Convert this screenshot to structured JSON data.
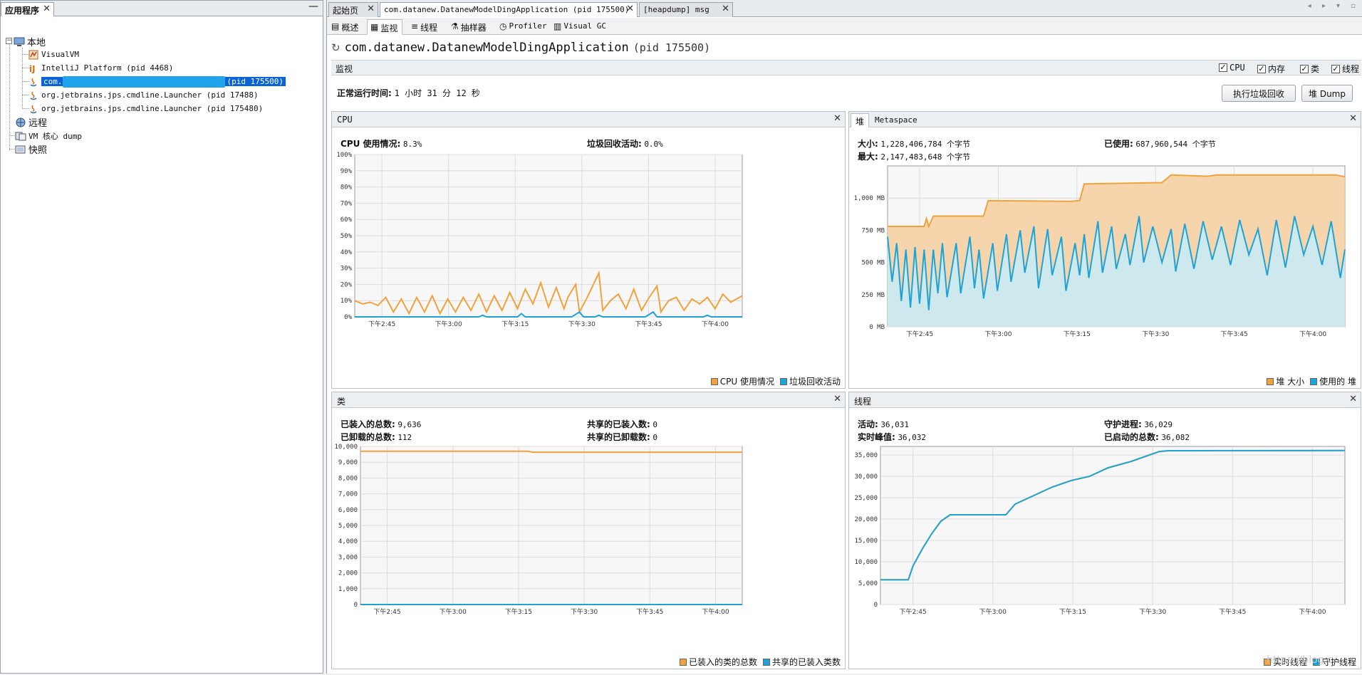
{
  "colors": {
    "orange": "#f2a23c",
    "orange_fill": "#f7cf9f",
    "blue": "#1fa3d4",
    "blue_fill": "#c7ecf9",
    "selection": "#0a64d8",
    "grid": "#d8d8d8"
  },
  "left": {
    "tab_label": "应用程序",
    "tree": {
      "local": "本地",
      "visualvm": "VisualVM",
      "intellij": "IntelliJ Platform (pid 4468)",
      "selected_prefix": "com.",
      "selected_pid": "(pid 175500)",
      "launcher1": "org.jetbrains.jps.cmdline.Launcher (pid 17488)",
      "launcher2": "org.jetbrains.jps.cmdline.Launcher (pid 175480)",
      "remote": "远程",
      "vm_core": "VM 核心 dump",
      "snapshot": "快照"
    }
  },
  "tabs": {
    "start": "起始页",
    "app": "com.datanew.DatanewModelDingApplication (pid 175500)",
    "heapdump": "[heapdump] msg"
  },
  "subtabs": {
    "overview": "概述",
    "monitor": "监视",
    "threads": "线程",
    "sampler": "抽样器",
    "profiler": "Profiler",
    "visualgc": "Visual GC"
  },
  "header": {
    "name": "com.datanew.DatanewModelDingApplication",
    "pid": "(pid 175500)",
    "monitor_label": "监视",
    "checks": {
      "cpu": "CPU",
      "memory": "内存",
      "classes": "类",
      "threads": "线程"
    },
    "uptime_label": "正常运行时间:",
    "uptime_value": "1 小时 31 分 12 秒",
    "gc_button": "执行垃圾回收",
    "heap_dump_button": "堆 Dump",
    "check_mark": "✓"
  },
  "cpu_panel": {
    "title": "CPU",
    "usage_label": "CPU 使用情况:",
    "usage_value": "8.3%",
    "gc_label": "垃圾回收活动:",
    "gc_value": "0.0%"
  },
  "heap_panel": {
    "tab_heap": "堆",
    "tab_metaspace": "Metaspace",
    "size_label": "大小:",
    "size_value": "1,228,406,784 个字节",
    "max_label": "最大:",
    "max_value": "2,147,483,648 个字节",
    "used_label": "已使用:",
    "used_value": "687,960,544 个字节"
  },
  "classes_panel": {
    "title": "类",
    "loaded_label": "已装入的总数:",
    "loaded_value": "9,636",
    "unloaded_label": "已卸载的总数:",
    "unloaded_value": "112",
    "shared_loaded_label": "共享的已装入数:",
    "shared_loaded_value": "0",
    "shared_unloaded_label": "共享的已卸载数:",
    "shared_unloaded_value": "0"
  },
  "threads_panel": {
    "title": "线程",
    "live_label": "活动:",
    "live_value": "36,031",
    "peak_label": "实时峰值:",
    "peak_value": "36,032",
    "daemon_label": "守护进程:",
    "daemon_value": "36,029",
    "started_label": "已启动的总数:",
    "started_value": "36,082"
  },
  "watermark": "https://blog.c...",
  "chart_data": [
    {
      "id": "cpu",
      "type": "line",
      "x": [
        "下午2:45",
        "下午3:00",
        "下午3:15",
        "下午3:30",
        "下午3:45",
        "下午4:00"
      ],
      "yticks": [
        "0%",
        "10%",
        "20%",
        "30%",
        "40%",
        "50%",
        "60%",
        "70%",
        "80%",
        "90%",
        "100%"
      ],
      "ylim": [
        0,
        100
      ],
      "series": [
        {
          "name": "CPU 使用情况",
          "color": "#f2a23c",
          "points": [
            [
              0,
              10
            ],
            [
              0.02,
              8
            ],
            [
              0.04,
              9
            ],
            [
              0.06,
              7
            ],
            [
              0.08,
              12
            ],
            [
              0.1,
              3
            ],
            [
              0.12,
              11
            ],
            [
              0.14,
              2
            ],
            [
              0.16,
              12
            ],
            [
              0.18,
              3
            ],
            [
              0.2,
              13
            ],
            [
              0.22,
              2
            ],
            [
              0.24,
              11
            ],
            [
              0.26,
              3
            ],
            [
              0.28,
              12
            ],
            [
              0.3,
              4
            ],
            [
              0.32,
              14
            ],
            [
              0.34,
              3
            ],
            [
              0.36,
              13
            ],
            [
              0.38,
              4
            ],
            [
              0.4,
              15
            ],
            [
              0.42,
              5
            ],
            [
              0.44,
              17
            ],
            [
              0.46,
              8
            ],
            [
              0.48,
              21
            ],
            [
              0.5,
              6
            ],
            [
              0.52,
              18
            ],
            [
              0.54,
              5
            ],
            [
              0.55,
              12
            ],
            [
              0.57,
              20
            ],
            [
              0.58,
              3
            ],
            [
              0.6,
              12
            ],
            [
              0.63,
              27
            ],
            [
              0.64,
              4
            ],
            [
              0.66,
              10
            ],
            [
              0.68,
              14
            ],
            [
              0.7,
              5
            ],
            [
              0.72,
              17
            ],
            [
              0.74,
              4
            ],
            [
              0.76,
              12
            ],
            [
              0.78,
              19
            ],
            [
              0.79,
              3
            ],
            [
              0.81,
              10
            ],
            [
              0.83,
              12
            ],
            [
              0.85,
              4
            ],
            [
              0.87,
              11
            ],
            [
              0.89,
              8
            ],
            [
              0.91,
              12
            ],
            [
              0.93,
              5
            ],
            [
              0.95,
              14
            ],
            [
              0.97,
              9
            ],
            [
              1,
              13
            ]
          ]
        },
        {
          "name": "垃圾回收活动",
          "color": "#1fa3d4",
          "points": [
            [
              0,
              0
            ],
            [
              0.32,
              0
            ],
            [
              0.33,
              1
            ],
            [
              0.34,
              0
            ],
            [
              0.42,
              0
            ],
            [
              0.43,
              2
            ],
            [
              0.44,
              0
            ],
            [
              0.56,
              0
            ],
            [
              0.58,
              3
            ],
            [
              0.59,
              0
            ],
            [
              0.62,
              0
            ],
            [
              0.63,
              1
            ],
            [
              0.64,
              0
            ],
            [
              0.75,
              0
            ],
            [
              0.77,
              3
            ],
            [
              0.78,
              0
            ],
            [
              0.9,
              0
            ],
            [
              0.91,
              1
            ],
            [
              0.92,
              0
            ],
            [
              1,
              0
            ]
          ]
        }
      ]
    },
    {
      "id": "heap",
      "type": "area",
      "x": [
        "下午2:45",
        "下午3:00",
        "下午3:15",
        "下午3:30",
        "下午3:45",
        "下午4:00"
      ],
      "yticks": [
        "0 MB",
        "250 MB",
        "500 MB",
        "750 MB",
        "1,000 MB"
      ],
      "ylim": [
        0,
        1250
      ],
      "series": [
        {
          "name": "堆 大小",
          "color": "#f2a23c",
          "fill": "#f7cf9f",
          "points": [
            [
              0,
              780
            ],
            [
              0.08,
              780
            ],
            [
              0.085,
              840
            ],
            [
              0.09,
              780
            ],
            [
              0.1,
              860
            ],
            [
              0.21,
              860
            ],
            [
              0.22,
              980
            ],
            [
              0.4,
              975
            ],
            [
              0.42,
              980
            ],
            [
              0.43,
              1110
            ],
            [
              0.6,
              1120
            ],
            [
              0.62,
              1180
            ],
            [
              0.7,
              1170
            ],
            [
              0.72,
              1180
            ],
            [
              0.98,
              1180
            ],
            [
              1,
              1165
            ]
          ]
        },
        {
          "name": "使用的 堆",
          "color": "#1fa3d4",
          "fill": "#c7ecf9",
          "points": [
            [
              0,
              700
            ],
            [
              0.01,
              350
            ],
            [
              0.02,
              650
            ],
            [
              0.03,
              200
            ],
            [
              0.04,
              600
            ],
            [
              0.05,
              150
            ],
            [
              0.06,
              620
            ],
            [
              0.07,
              180
            ],
            [
              0.08,
              600
            ],
            [
              0.09,
              130
            ],
            [
              0.1,
              600
            ],
            [
              0.11,
              260
            ],
            [
              0.12,
              650
            ],
            [
              0.13,
              230
            ],
            [
              0.15,
              650
            ],
            [
              0.16,
              260
            ],
            [
              0.18,
              700
            ],
            [
              0.19,
              300
            ],
            [
              0.2,
              600
            ],
            [
              0.21,
              220
            ],
            [
              0.23,
              650
            ],
            [
              0.24,
              280
            ],
            [
              0.26,
              720
            ],
            [
              0.27,
              350
            ],
            [
              0.29,
              750
            ],
            [
              0.3,
              420
            ],
            [
              0.32,
              780
            ],
            [
              0.33,
              300
            ],
            [
              0.35,
              760
            ],
            [
              0.36,
              400
            ],
            [
              0.38,
              700
            ],
            [
              0.39,
              280
            ],
            [
              0.41,
              650
            ],
            [
              0.42,
              400
            ],
            [
              0.43,
              720
            ],
            [
              0.44,
              380
            ],
            [
              0.46,
              820
            ],
            [
              0.47,
              420
            ],
            [
              0.49,
              780
            ],
            [
              0.5,
              450
            ],
            [
              0.52,
              720
            ],
            [
              0.53,
              480
            ],
            [
              0.55,
              860
            ],
            [
              0.56,
              500
            ],
            [
              0.58,
              780
            ],
            [
              0.6,
              500
            ],
            [
              0.62,
              760
            ],
            [
              0.63,
              430
            ],
            [
              0.65,
              800
            ],
            [
              0.67,
              450
            ],
            [
              0.69,
              820
            ],
            [
              0.71,
              520
            ],
            [
              0.73,
              780
            ],
            [
              0.75,
              480
            ],
            [
              0.77,
              830
            ],
            [
              0.79,
              560
            ],
            [
              0.81,
              760
            ],
            [
              0.83,
              400
            ],
            [
              0.85,
              830
            ],
            [
              0.87,
              460
            ],
            [
              0.89,
              860
            ],
            [
              0.91,
              560
            ],
            [
              0.93,
              780
            ],
            [
              0.95,
              480
            ],
            [
              0.97,
              820
            ],
            [
              0.99,
              380
            ],
            [
              1,
              600
            ]
          ]
        }
      ]
    },
    {
      "id": "classes",
      "type": "line",
      "x": [
        "下午2:45",
        "下午3:00",
        "下午3:15",
        "下午3:30",
        "下午3:45",
        "下午4:00"
      ],
      "yticks": [
        "0",
        "1,000",
        "2,000",
        "3,000",
        "4,000",
        "5,000",
        "6,000",
        "7,000",
        "8,000",
        "9,000",
        "10,000"
      ],
      "ylim": [
        0,
        10000
      ],
      "series": [
        {
          "name": "已装入的类的总数",
          "color": "#f2a23c",
          "points": [
            [
              0,
              9700
            ],
            [
              0.44,
              9700
            ],
            [
              0.45,
              9636
            ],
            [
              1,
              9636
            ]
          ]
        },
        {
          "name": "共享的已装入类数",
          "color": "#1fa3d4",
          "points": [
            [
              0,
              0
            ],
            [
              1,
              0
            ]
          ]
        }
      ]
    },
    {
      "id": "threads",
      "type": "line",
      "x": [
        "下午2:45",
        "下午3:00",
        "下午3:15",
        "下午3:30",
        "下午3:45",
        "下午4:00"
      ],
      "yticks": [
        "0",
        "5,000",
        "10,000",
        "15,000",
        "20,000",
        "25,000",
        "30,000",
        "35,000"
      ],
      "ylim": [
        0,
        37000
      ],
      "series": [
        {
          "name": "实时线程",
          "color": "#f2a23c",
          "points": [
            [
              0,
              5800
            ],
            [
              0.06,
              5800
            ],
            [
              0.07,
              9000
            ],
            [
              0.09,
              13000
            ],
            [
              0.11,
              16500
            ],
            [
              0.13,
              19500
            ],
            [
              0.15,
              21000
            ],
            [
              0.27,
              21000
            ],
            [
              0.29,
              23500
            ],
            [
              0.33,
              25500
            ],
            [
              0.37,
              27500
            ],
            [
              0.41,
              29000
            ],
            [
              0.45,
              30000
            ],
            [
              0.49,
              32000
            ],
            [
              0.54,
              33500
            ],
            [
              0.6,
              35800
            ],
            [
              0.62,
              36000
            ],
            [
              1,
              36031
            ]
          ]
        },
        {
          "name": "守护线程",
          "color": "#1fa3d4",
          "points": [
            [
              0,
              5800
            ],
            [
              0.06,
              5800
            ],
            [
              0.07,
              9000
            ],
            [
              0.09,
              13000
            ],
            [
              0.11,
              16500
            ],
            [
              0.13,
              19500
            ],
            [
              0.15,
              21000
            ],
            [
              0.27,
              21000
            ],
            [
              0.29,
              23500
            ],
            [
              0.33,
              25500
            ],
            [
              0.37,
              27500
            ],
            [
              0.41,
              29000
            ],
            [
              0.45,
              30000
            ],
            [
              0.49,
              32000
            ],
            [
              0.54,
              33500
            ],
            [
              0.6,
              35800
            ],
            [
              0.62,
              36000
            ],
            [
              1,
              36029
            ]
          ]
        }
      ]
    }
  ]
}
